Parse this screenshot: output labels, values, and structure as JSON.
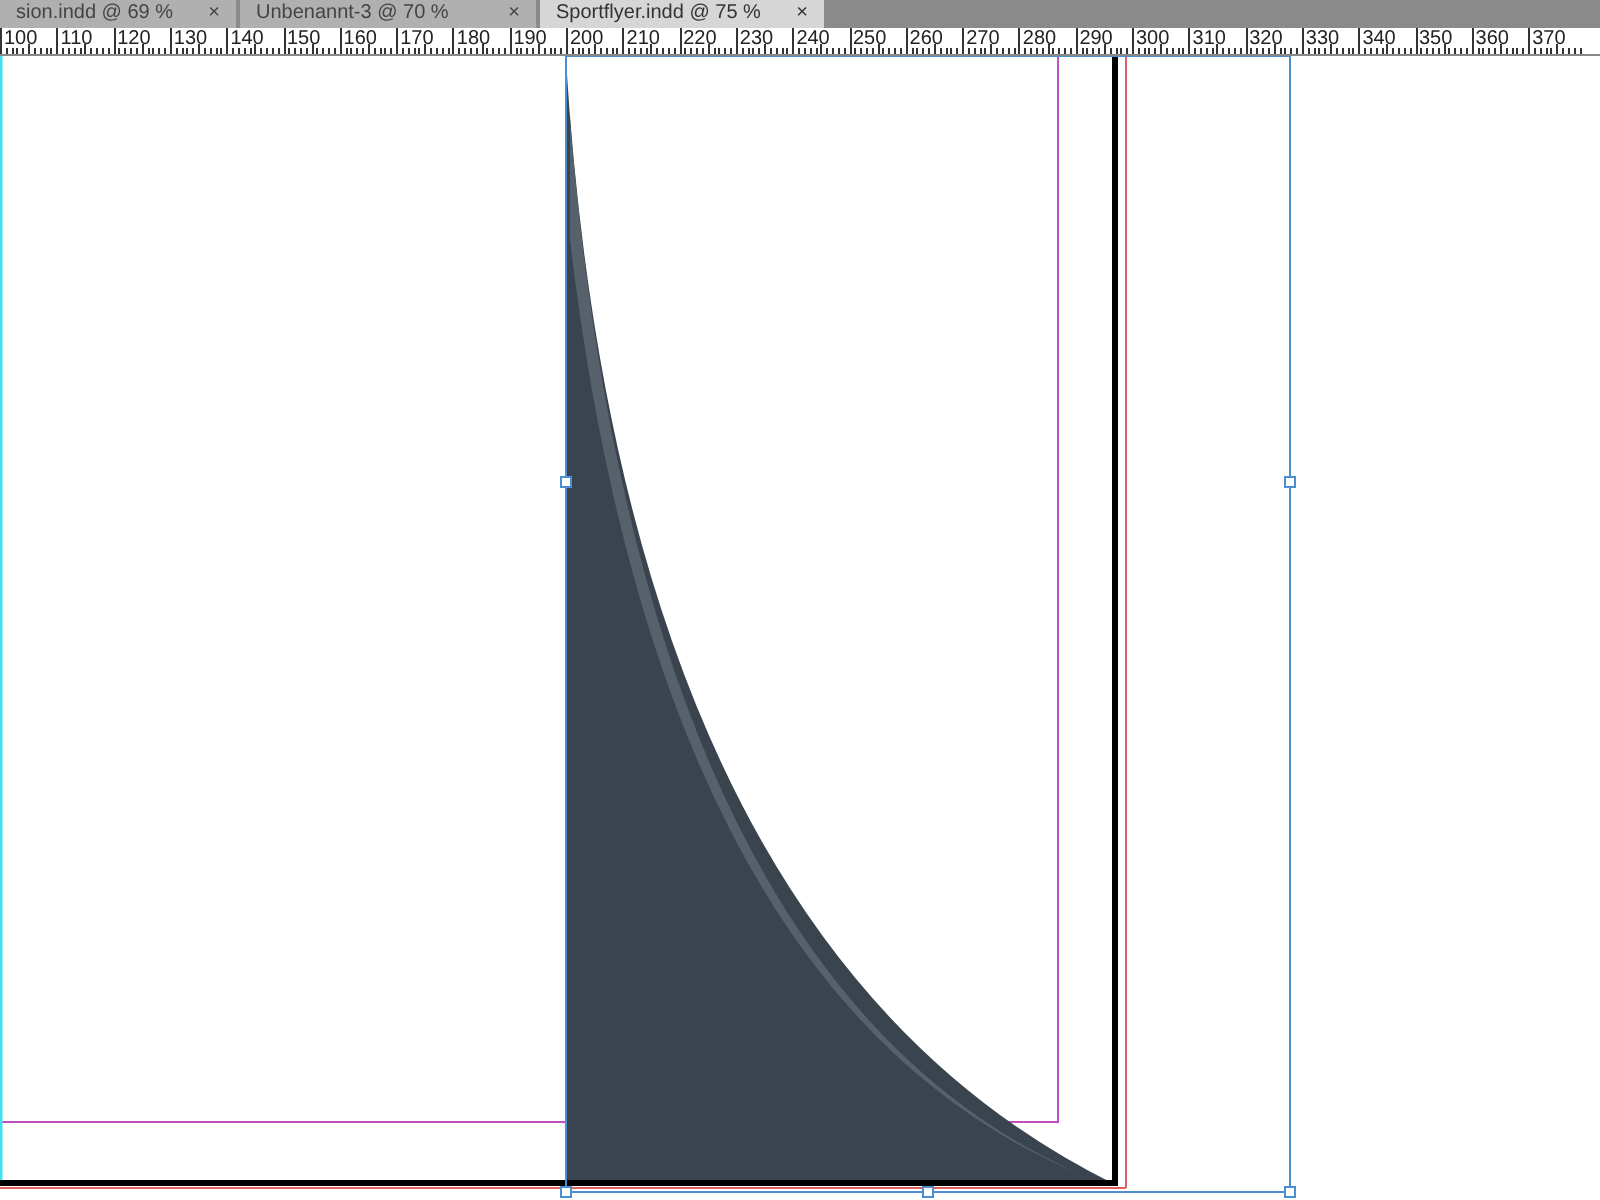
{
  "tabs": [
    {
      "label": "sion.indd @ 69 %",
      "close": "×",
      "selected": false
    },
    {
      "label": "Unbenannt-3 @ 70 %",
      "close": "×",
      "selected": false
    },
    {
      "label": "Sportflyer.indd @ 75 %",
      "close": "×",
      "selected": true
    }
  ],
  "ruler": {
    "labels": [
      "100",
      "110",
      "120",
      "130",
      "140",
      "150",
      "160",
      "170",
      "180",
      "190",
      "200",
      "210",
      "220",
      "230",
      "240",
      "250",
      "260",
      "270",
      "280",
      "290",
      "300",
      "310",
      "320",
      "330",
      "340",
      "350",
      "360",
      "370"
    ]
  }
}
